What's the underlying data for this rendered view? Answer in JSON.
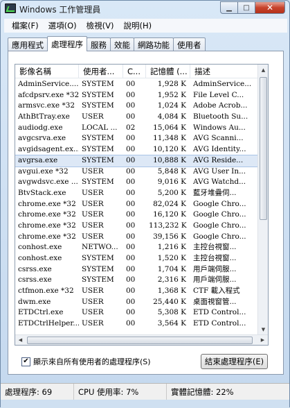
{
  "window": {
    "title": "Windows 工作管理員"
  },
  "menu": [
    "檔案(F)",
    "選項(O)",
    "檢視(V)",
    "說明(H)"
  ],
  "tabs": [
    {
      "label": "應用程式",
      "active": false
    },
    {
      "label": "處理程序",
      "active": true
    },
    {
      "label": "服務",
      "active": false
    },
    {
      "label": "效能",
      "active": false
    },
    {
      "label": "網路功能",
      "active": false
    },
    {
      "label": "使用者",
      "active": false
    }
  ],
  "columns": [
    "影像名稱",
    "使用者...",
    "C...",
    "記憶體 (...",
    "描述"
  ],
  "processes": [
    [
      "AdminService....",
      "SYSTEM",
      "00",
      "1,928 K",
      "AdminService..."
    ],
    [
      "afcdpsrv.exe *32",
      "SYSTEM",
      "00",
      "1,952 K",
      "File Level C..."
    ],
    [
      "armsvc.exe *32",
      "SYSTEM",
      "00",
      "1,024 K",
      "Adobe Acrob..."
    ],
    [
      "AthBtTray.exe",
      "USER",
      "00",
      "4,084 K",
      "Bluetooth Su..."
    ],
    [
      "audiodg.exe",
      "LOCAL ...",
      "02",
      "15,064 K",
      "Windows Au..."
    ],
    [
      "avgcsrva.exe",
      "SYSTEM",
      "00",
      "11,348 K",
      "AVG Scanni..."
    ],
    [
      "avgidsagent.ex...",
      "SYSTEM",
      "00",
      "10,120 K",
      "AVG Identity..."
    ],
    [
      "avgrsa.exe",
      "SYSTEM",
      "00",
      "10,888 K",
      "AVG Reside..."
    ],
    [
      "avgui.exe *32",
      "USER",
      "00",
      "5,848 K",
      "AVG User In..."
    ],
    [
      "avgwdsvc.exe ...",
      "SYSTEM",
      "00",
      "9,016 K",
      "AVG Watchd..."
    ],
    [
      "BtvStack.exe",
      "USER",
      "00",
      "5,200 K",
      "藍牙堆疊伺..."
    ],
    [
      "chrome.exe *32",
      "USER",
      "00",
      "82,024 K",
      "Google Chro..."
    ],
    [
      "chrome.exe *32",
      "USER",
      "00",
      "16,120 K",
      "Google Chro..."
    ],
    [
      "chrome.exe *32",
      "USER",
      "00",
      "113,232 K",
      "Google Chro..."
    ],
    [
      "chrome.exe *32",
      "USER",
      "00",
      "39,156 K",
      "Google Chro..."
    ],
    [
      "conhost.exe",
      "NETWO...",
      "00",
      "1,216 K",
      "主控台視窗..."
    ],
    [
      "conhost.exe",
      "SYSTEM",
      "00",
      "1,520 K",
      "主控台視窗..."
    ],
    [
      "csrss.exe",
      "SYSTEM",
      "00",
      "1,704 K",
      "用戶端伺服..."
    ],
    [
      "csrss.exe",
      "SYSTEM",
      "00",
      "2,316 K",
      "用戶端伺服..."
    ],
    [
      "ctfmon.exe *32",
      "USER",
      "00",
      "1,368 K",
      "CTF 載入程式"
    ],
    [
      "dwm.exe",
      "USER",
      "00",
      "25,440 K",
      "桌面視窗管..."
    ],
    [
      "ETDCtrl.exe",
      "USER",
      "00",
      "5,308 K",
      "ETD Control..."
    ],
    [
      "ETDCtrlHelper....",
      "USER",
      "00",
      "3,564 K",
      "ETD Control..."
    ]
  ],
  "selected_process": "avgrsa.exe",
  "show_all_label": "顯示來自所有使用者的處理程序(S)",
  "show_all_checked": true,
  "end_process_label": "結束處理程序(E)",
  "status": {
    "processes": "處理程序: 69",
    "cpu": "CPU 使用率: 7%",
    "memory": "實體記憶體: 22%"
  }
}
